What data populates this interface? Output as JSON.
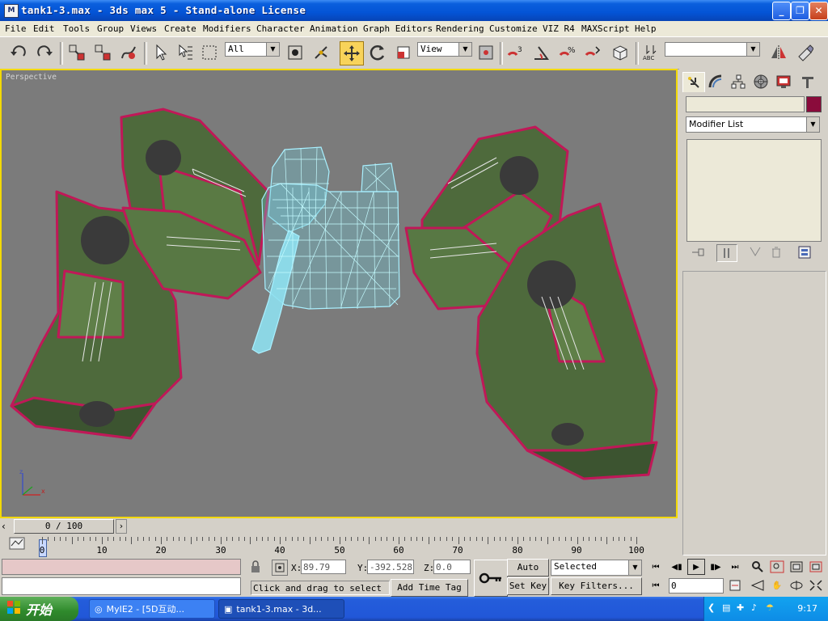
{
  "window": {
    "title": "tank1-3.max - 3ds max 5 - Stand-alone License",
    "icon": "3ds-max-icon"
  },
  "menu": [
    "File",
    "Edit",
    "Tools",
    "Group",
    "Views",
    "Create",
    "Modifiers",
    "Character",
    "Animation",
    "Graph Editors",
    "Rendering",
    "Customize",
    "VIZ R4",
    "MAXScript",
    "Help"
  ],
  "toolbar": {
    "selection_filter": "All",
    "ref_coord": "View",
    "named_selection": ""
  },
  "viewport": {
    "label": "Perspective",
    "axis_z": "z",
    "axis_x": "x"
  },
  "command_panel": {
    "object_name": "",
    "object_color": "#8a0b3b",
    "modifier_list": "Modifier List"
  },
  "timeline": {
    "frame_display": "0 / 100",
    "ticks": [
      "0",
      "10",
      "20",
      "30",
      "40",
      "50",
      "60",
      "70",
      "80",
      "90",
      "100"
    ]
  },
  "status": {
    "x_label": "X:",
    "x_value": "89.79",
    "y_label": "Y:",
    "y_value": "-392.528",
    "z_label": "Z:",
    "z_value": "0.0",
    "prompt": "Click and drag to select",
    "add_time_tag": "Add Time Tag",
    "auto_key": "Auto Key",
    "set_key": "Set Key",
    "key_mode": "Selected",
    "key_filters": "Key Filters...",
    "current_frame": "0"
  },
  "taskbar": {
    "start_label": "开始",
    "tasks": [
      "MyIE2 - [5D互动...",
      "tank1-3.max - 3d..."
    ],
    "clock": "9:17"
  }
}
